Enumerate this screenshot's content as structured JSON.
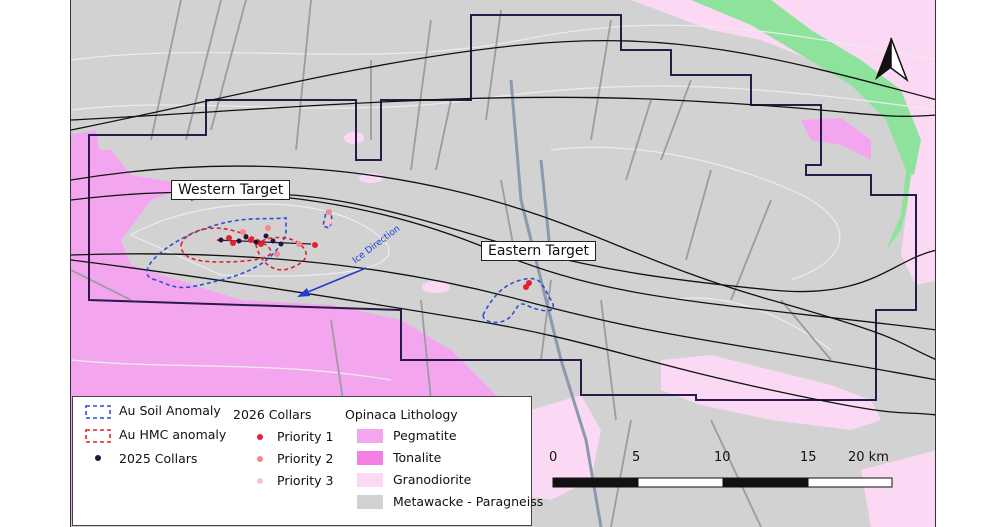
{
  "map": {
    "labels": {
      "western_target": "Western Target",
      "eastern_target": "Eastern Target",
      "ice_direction": "Ice Direction"
    },
    "north_arrow": "north-arrow-icon"
  },
  "legend": {
    "au_soil": "Au Soil Anomaly",
    "au_hmc": "Au HMC anomaly",
    "collars_2025": "2025 Collars",
    "collars_2026_title": "2026 Collars",
    "priority_1": "Priority 1",
    "priority_2": "Priority 2",
    "priority_3": "Priority 3",
    "lithology_title": "Opinaca Lithology",
    "pegmatite": "Pegmatite",
    "tonalite": "Tonalite",
    "granodiorite": "Granodiorite",
    "metawacke": "Metawacke - Paragneiss"
  },
  "scale_bar": {
    "ticks": [
      "0",
      "5",
      "10",
      "15",
      "20 km"
    ]
  },
  "colors": {
    "metawacke": "#d2d2d2",
    "pegmatite": "#f3a6ef",
    "tonalite": "#f57fe6",
    "granodiorite": "#fbd9f5",
    "green_unit": "#8ee39c",
    "soil_anomaly": "#2d4fd6",
    "hmc_anomaly": "#e02424",
    "priority_1": "#e8202a",
    "priority_2": "#f08a8e",
    "priority_3": "#f6c3c6",
    "collars_2025": "#2a1240",
    "claim_boundary": "#2a1a4a",
    "ice_arrow": "#1f3bd0"
  }
}
